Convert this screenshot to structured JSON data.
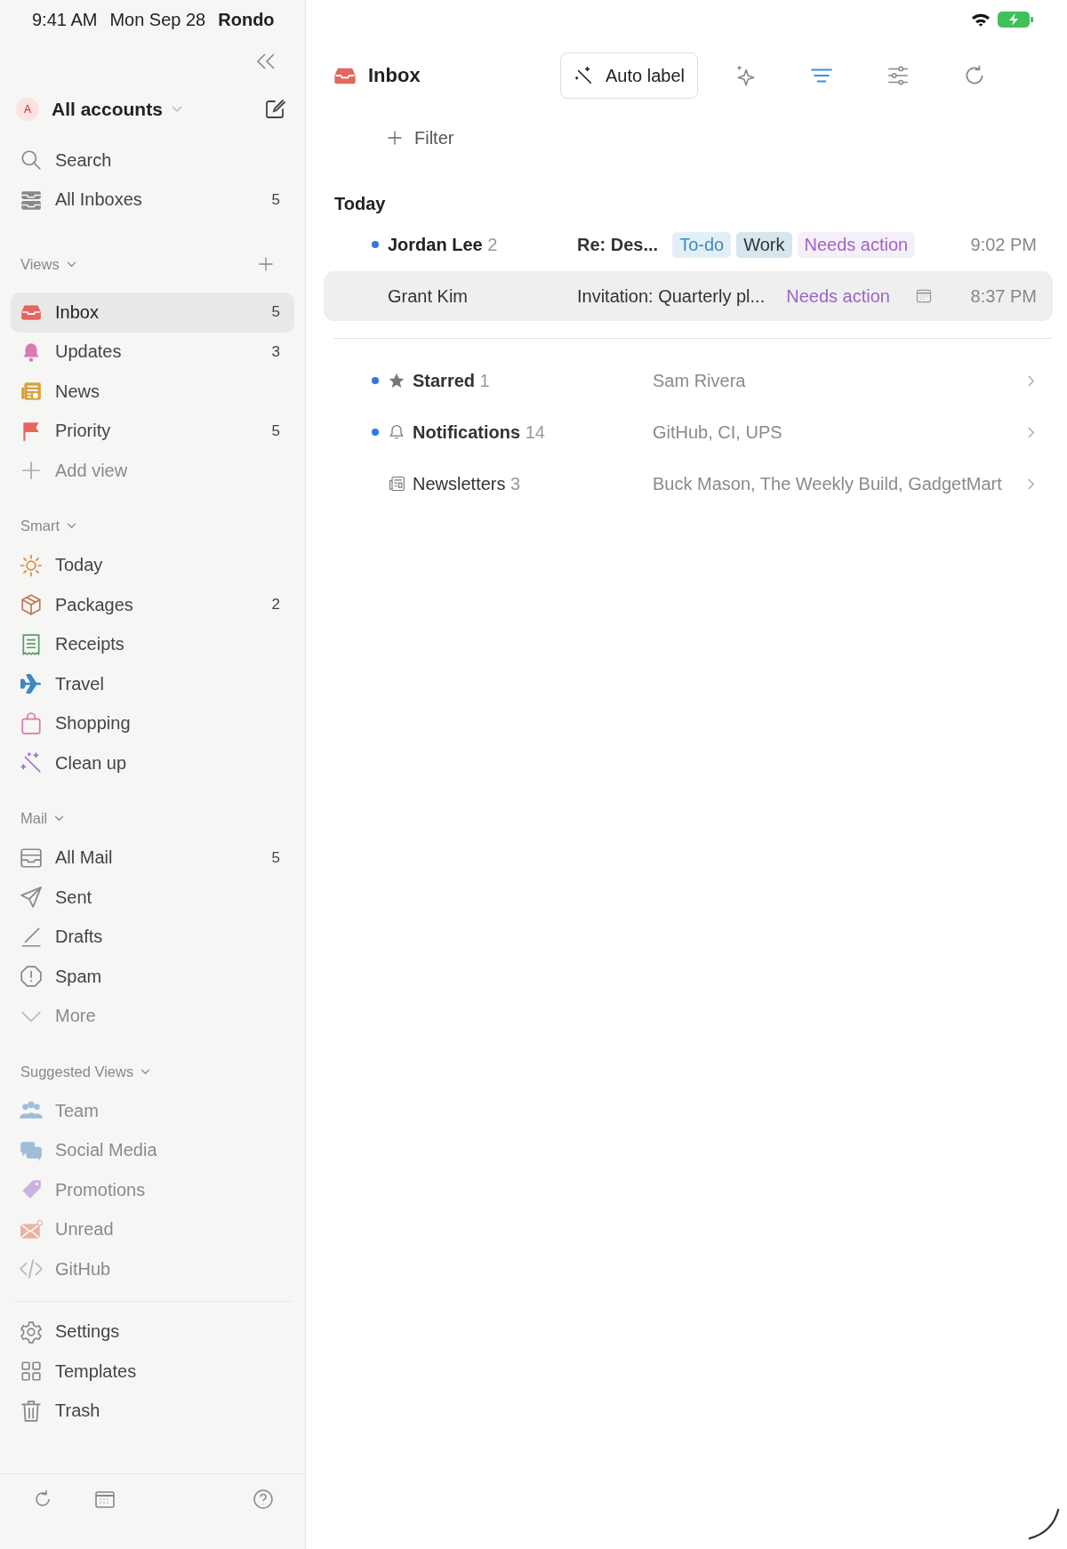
{
  "status_bar": {
    "time": "9:41 AM",
    "date": "Mon Sep 28",
    "app": "Rondo"
  },
  "sidebar": {
    "account": {
      "initial": "A",
      "label": "All accounts"
    },
    "top_items": [
      {
        "label": "Search",
        "selected": false
      },
      {
        "label": "All Inboxes",
        "count": "5",
        "selected": false
      }
    ],
    "sections": [
      {
        "title": "Views",
        "items": [
          {
            "label": "Inbox",
            "count": "5",
            "selected": true
          },
          {
            "label": "Updates",
            "count": "3",
            "selected": false
          },
          {
            "label": "News",
            "selected": false
          },
          {
            "label": "Priority",
            "count": "5",
            "selected": false
          }
        ],
        "add_label": "Add view"
      },
      {
        "title": "Smart",
        "items": [
          {
            "label": "Today",
            "selected": false
          },
          {
            "label": "Packages",
            "count": "2",
            "selected": false
          },
          {
            "label": "Receipts",
            "selected": false
          },
          {
            "label": "Travel",
            "selected": false
          },
          {
            "label": "Shopping",
            "selected": false
          },
          {
            "label": "Clean up",
            "selected": false
          }
        ]
      },
      {
        "title": "Mail",
        "items": [
          {
            "label": "All Mail",
            "count": "5",
            "selected": false
          },
          {
            "label": "Sent",
            "selected": false
          },
          {
            "label": "Drafts",
            "selected": false
          },
          {
            "label": "Spam",
            "selected": false
          }
        ],
        "more_label": "More"
      },
      {
        "title": "Suggested Views",
        "items": [
          {
            "label": "Team",
            "selected": false
          },
          {
            "label": "Social Media",
            "selected": false
          },
          {
            "label": "Promotions",
            "selected": false
          },
          {
            "label": "Unread",
            "selected": false
          },
          {
            "label": "GitHub",
            "selected": false
          }
        ]
      }
    ],
    "bottom_items": [
      {
        "label": "Settings",
        "selected": false
      },
      {
        "label": "Templates",
        "selected": false
      },
      {
        "label": "Trash",
        "selected": false
      }
    ]
  },
  "main": {
    "title": "Inbox",
    "auto_label": "Auto label",
    "filter": "Filter",
    "group_title": "Today",
    "threads": [
      {
        "sender": "Jordan Lee",
        "count": "2",
        "subject": "Re: Des...",
        "tags": [
          {
            "label": "To-do",
            "kind": "todo"
          },
          {
            "label": "Work",
            "kind": "work"
          },
          {
            "label": "Needs action",
            "kind": "action"
          }
        ],
        "invite": false,
        "time": "9:02 PM",
        "unread": true,
        "selected": false
      },
      {
        "sender": "Grant Kim",
        "subject": "Invitation: Quarterly pl...",
        "tags": [
          {
            "label": "Needs action",
            "kind": "action"
          }
        ],
        "invite": true,
        "time": "8:37 PM",
        "unread": false,
        "selected": true
      }
    ],
    "bundles": [
      {
        "label": "Starred",
        "count": "1",
        "senders": "Sam Rivera",
        "unread": true
      },
      {
        "label": "Notifications",
        "count": "14",
        "senders": "GitHub, CI, UPS",
        "unread": true
      },
      {
        "label": "Newsletters",
        "count": "3",
        "senders": "Buck Mason, The Weekly Build, GadgetMart",
        "unread": false
      }
    ]
  }
}
